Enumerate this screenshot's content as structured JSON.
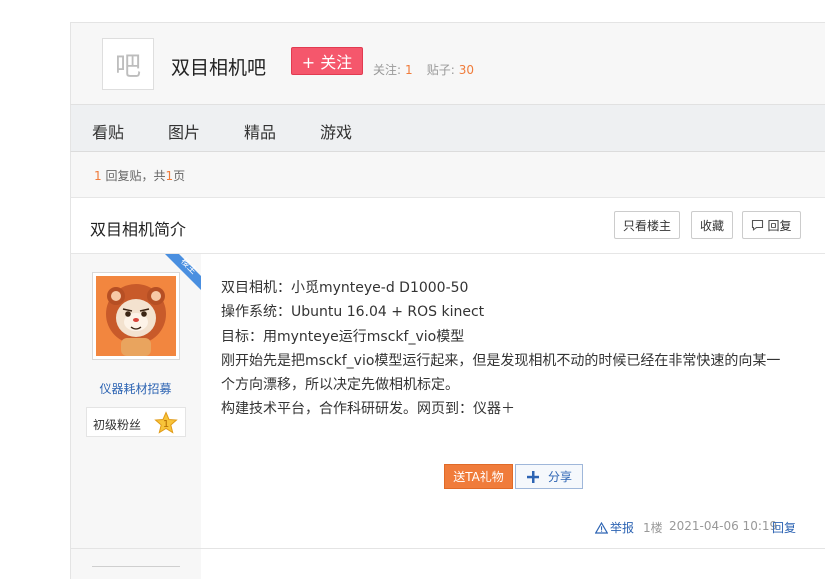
{
  "forum": {
    "avatar_char": "吧",
    "name": "双目相机吧",
    "follow_label": "+ 关注",
    "follow_count_label": "关注:",
    "follow_count": "1",
    "post_count_label": "贴子:",
    "post_count": "30"
  },
  "nav": {
    "items": [
      {
        "label": "看贴"
      },
      {
        "label": "图片"
      },
      {
        "label": "精品"
      },
      {
        "label": "游戏"
      }
    ]
  },
  "reply_info": {
    "count": "1",
    "replies_text": " 回复贴，共",
    "pages": "1",
    "pages_suffix": "页"
  },
  "thread": {
    "title": "双目相机简介",
    "only_op_label": "只看楼主",
    "favorite_label": "收藏",
    "reply_label": "回复"
  },
  "post": {
    "ribbon_label": "楼主",
    "username": "仪器耗材招募",
    "level_title": "初级粉丝",
    "level_number": "1",
    "lines": [
      "双目相机：小觅mynteye-d D1000-50",
      "操作系统：Ubuntu 16.04 + ROS kinect",
      "目标：用mynteye运行msckf_vio模型",
      "刚开始先是把msckf_vio模型运行起来，但是发现相机不动的时候已经在非常快速的向某一",
      "个方向漂移，所以决定先做相机标定。",
      "构建技术平台，合作科研研发。网页到：仪器＋"
    ],
    "gift_label": "送TA礼物",
    "share_label": "分享",
    "report_label": "举报",
    "floor": "1楼",
    "time": "2021-04-06 10:19",
    "reply_label": "回复"
  },
  "colors": {
    "accent_red": "#f5576c",
    "accent_orange": "#f07c3b",
    "link_blue": "#2d64b3",
    "ribbon_blue": "#4a8fe0"
  }
}
